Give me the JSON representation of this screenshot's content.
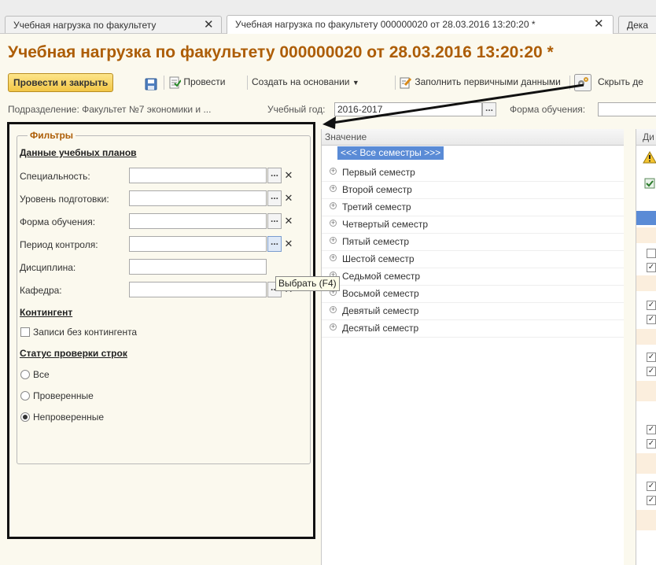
{
  "tabs": [
    {
      "label": "Учебная нагрузка по факультету",
      "close": "✕"
    },
    {
      "label": "Учебная нагрузка по факультету 000000020 от 28.03.2016 13:20:20 *",
      "close": "✕"
    },
    {
      "label": "Дека"
    }
  ],
  "form": {
    "title": "Учебная нагрузка по факультету 000000020 от 28.03.2016 13:20:20 *"
  },
  "toolbar": {
    "post_close": "Провести и закрыть",
    "post": "Провести",
    "create_based": "Создать на основании",
    "fill": "Заполнить первичными данными",
    "hide": "Скрыть де"
  },
  "header_fields": {
    "subdivision_label": "Подразделение:",
    "subdivision_value": "Факультет №7 экономики и ...",
    "year_label": "Учебный год:",
    "year_value": "2016-2017",
    "form_label": "Форма обучения:",
    "dots": "..."
  },
  "filters": {
    "title": "Фильтры",
    "section_plans": "Данные учебных планов",
    "fields": [
      {
        "label": "Специальность:"
      },
      {
        "label": "Уровень подготовки:"
      },
      {
        "label": "Форма обучения:"
      },
      {
        "label": "Период контроля:"
      },
      {
        "label": "Дисциплина:"
      },
      {
        "label": "Кафедра:"
      }
    ],
    "dots": "...",
    "clear": "✕",
    "section_contingent": "Контингент",
    "no_contingent": "Записи без контингента",
    "section_status": "Статус проверки строк",
    "status_options": [
      "Все",
      "Проверенные",
      "Непроверенные"
    ],
    "status_selected": "Непроверенные"
  },
  "tooltip": "Выбрать (F4)",
  "tree": {
    "header": "Значение",
    "selected": "<<< Все семестры >>>",
    "rows": [
      "Первый семестр",
      "Второй семестр",
      "Третий семестр",
      "Четвертый семестр",
      "Пятый семестр",
      "Шестой семестр",
      "Седьмой семестр",
      "Восьмой семестр",
      "Девятый семестр",
      "Десятый семестр"
    ],
    "expand": "+"
  },
  "right_panel": {
    "header": "Ди",
    "check": "✓"
  },
  "colors": {
    "title": "#ad5d06",
    "primary_button": "#f2c646",
    "selection": "#5a8bd6",
    "form_bg": "#fbf9ee"
  }
}
